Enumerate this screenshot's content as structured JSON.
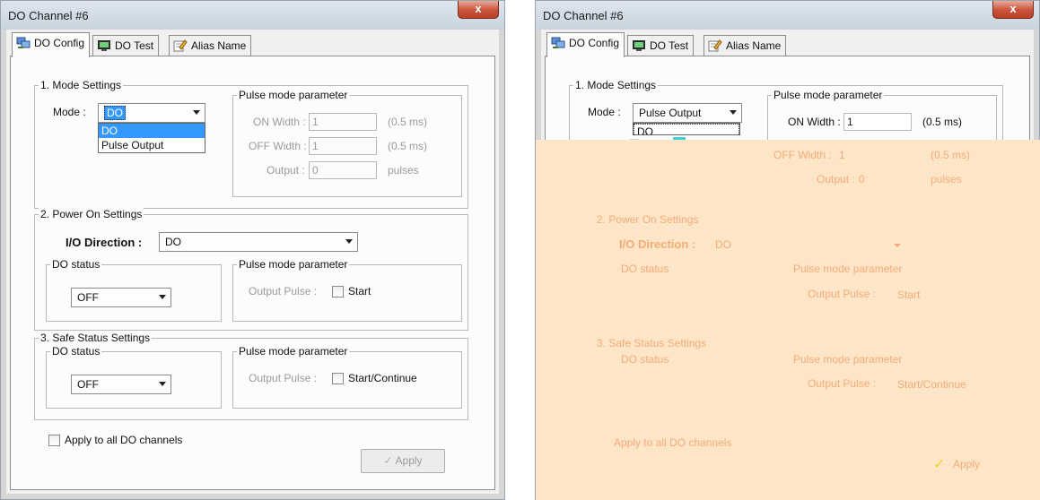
{
  "window": {
    "title": "DO Channel #6",
    "close_glyph": "x"
  },
  "tabs": [
    {
      "label": "DO Config",
      "icon": "network-config-icon",
      "active": true
    },
    {
      "label": "DO Test",
      "icon": "monitor-icon",
      "active": false
    },
    {
      "label": "Alias Name",
      "icon": "edit-pencil-icon",
      "active": false
    }
  ],
  "mode_settings": {
    "title": "1. Mode Settings",
    "mode_label": "Mode :",
    "mode_value_left": "DO",
    "mode_value_right": "Pulse Output",
    "options": [
      "DO",
      "Pulse Output"
    ],
    "pulse_title": "Pulse mode parameter",
    "on_width_label": "ON Width :",
    "on_width_value": "1",
    "off_width_label": "OFF Width :",
    "off_width_value": "1",
    "output_label": "Output :",
    "output_value": "0",
    "unit_ms": "(0.5 ms)",
    "unit_pulses": "pulses",
    "right_dropdown_option": "DO"
  },
  "power_on": {
    "title": "2. Power On Settings",
    "io_direction_label": "I/O Direction :",
    "io_direction_value": "DO",
    "do_status_title": "DO status",
    "do_status_value": "OFF",
    "pulse_title": "Pulse mode parameter",
    "output_pulse_label": "Output Pulse :",
    "output_pulse_text": "Start"
  },
  "safe_status": {
    "title": "3. Safe Status Settings",
    "do_status_title": "DO status",
    "do_status_value": "OFF",
    "pulse_title": "Pulse mode parameter",
    "output_pulse_label": "Output Pulse :",
    "output_pulse_text": "Start/Continue"
  },
  "footer": {
    "apply_all_label": "Apply to all DO channels",
    "apply_label": "Apply"
  },
  "colors": {
    "selection": "#3399ff",
    "ghost_text": "#f3ab78",
    "ghost_background": "#fde6c8"
  }
}
